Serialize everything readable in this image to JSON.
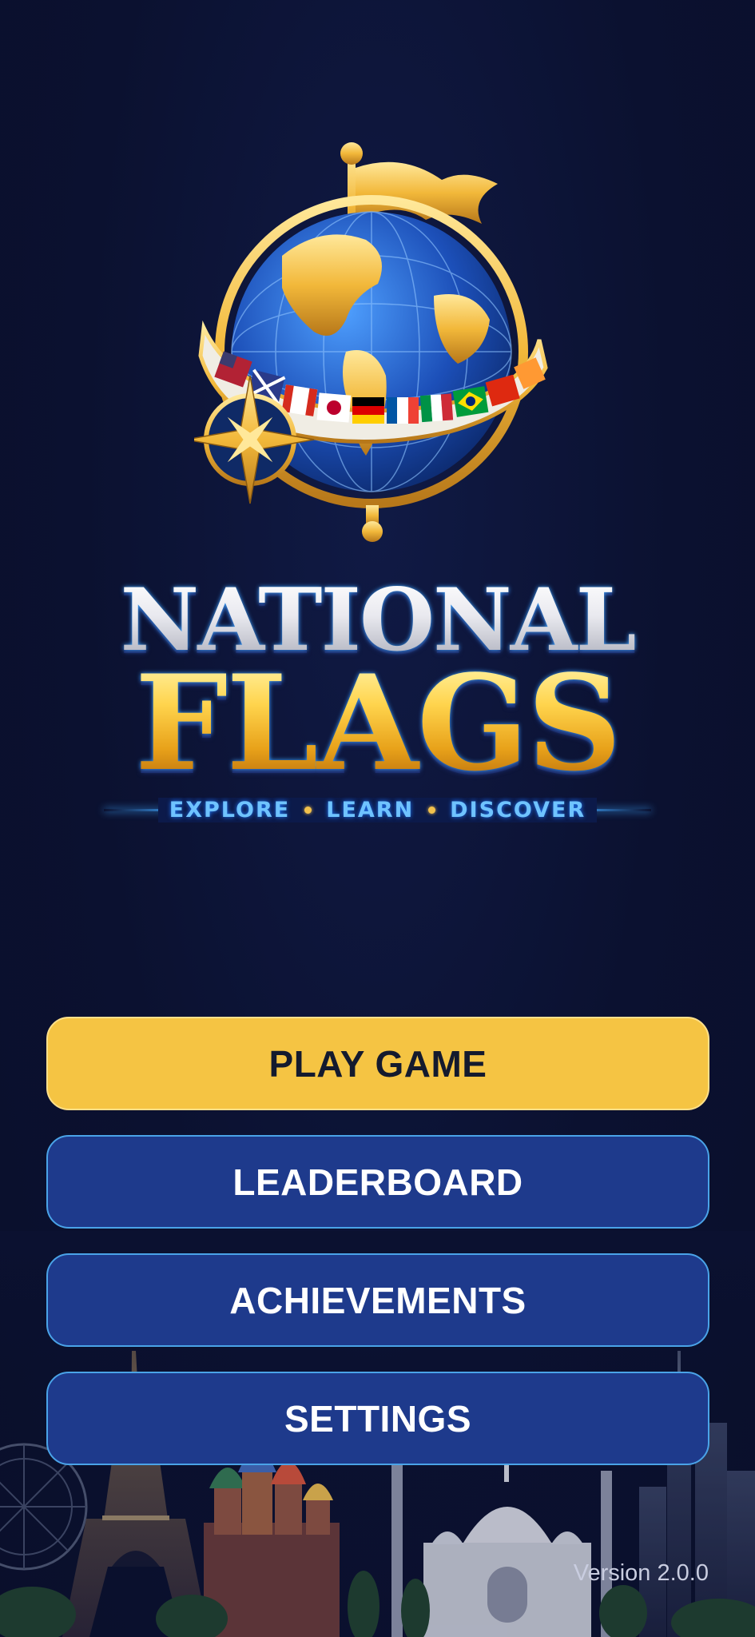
{
  "app": {
    "title_line1": "NATIONAL",
    "title_line2": "FLAGS",
    "tagline": [
      "EXPLORE",
      "LEARN",
      "DISCOVER"
    ]
  },
  "menu": {
    "play_label": "PLAY GAME",
    "leaderboard_label": "LEADERBOARD",
    "achievements_label": "ACHIEVEMENTS",
    "settings_label": "SETTINGS"
  },
  "footer": {
    "version": "Version 2.0.0"
  },
  "colors": {
    "background": "#0b1130",
    "primary_button": "#f5c443",
    "secondary_button": "#1e3a8c",
    "secondary_border": "#4aa3e8",
    "gold": "#f2c14c",
    "accent_blue": "#3ea6ff"
  },
  "icons": {
    "logo": "globe-with-flag-emblem",
    "compass": "compass-star-icon"
  }
}
